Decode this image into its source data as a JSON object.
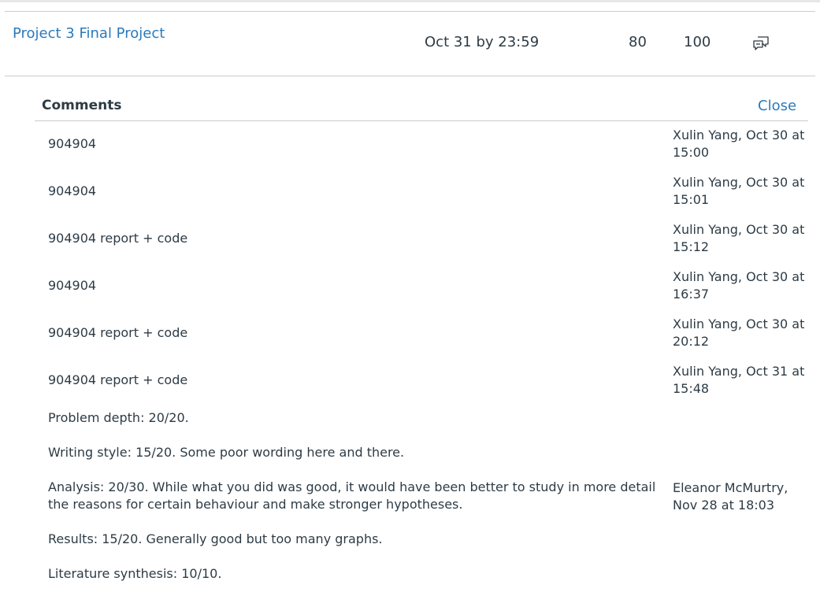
{
  "assignment": {
    "title": "Project 3 Final Project",
    "due": "Oct 31 by 23:59",
    "score": "80",
    "out_of": "100",
    "comments_icon": "speech-bubbles-icon"
  },
  "comments_panel": {
    "heading": "Comments",
    "close_label": "Close",
    "comments": [
      {
        "text": "904904",
        "author": "Xulin Yang, Oct 30 at 15:00"
      },
      {
        "text": "904904",
        "author": "Xulin Yang, Oct 30 at 15:01"
      },
      {
        "text": "904904 report + code",
        "author": "Xulin Yang, Oct 30 at 15:12"
      },
      {
        "text": "904904",
        "author": "Xulin Yang, Oct 30 at 16:37"
      },
      {
        "text": "904904 report + code",
        "author": "Xulin Yang, Oct 30 at 20:12"
      },
      {
        "text": "904904 report + code",
        "author": "Xulin Yang, Oct 31 at 15:48"
      }
    ],
    "feedback": {
      "author": "Eleanor McMurtry, Nov 28 at 18:03",
      "lines": [
        "Problem depth: 20/20.",
        "Writing style: 15/20. Some poor wording here and there.",
        "Analysis: 20/30. While what you did was good, it would have been better to study in more detail the reasons for certain behaviour and make stronger hypotheses.",
        "Results: 15/20. Generally good but too many graphs.",
        "Literature synthesis: 10/10."
      ]
    }
  },
  "colors": {
    "link": "#2b7abc",
    "text": "#2d3b45",
    "rule": "#c7cdd1"
  }
}
